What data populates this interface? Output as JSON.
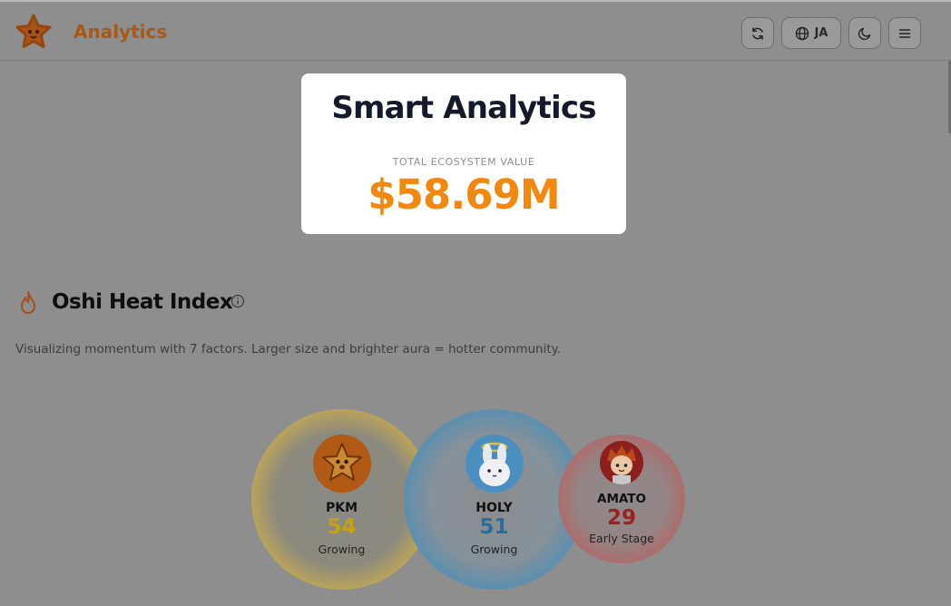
{
  "header": {
    "brand": "Analytics",
    "lang_label": "JA",
    "icons": [
      "refresh-icon",
      "globe-icon",
      "moon-icon",
      "menu-icon"
    ]
  },
  "card": {
    "title": "Smart Analytics",
    "label": "TOTAL ECOSYSTEM VALUE",
    "value": "$58.69M"
  },
  "section": {
    "title": "Oshi Heat Index",
    "description": "Visualizing momentum with 7 factors. Larger size and brighter aura = hotter community."
  },
  "bubbles": [
    {
      "name": "PKM",
      "score": "54",
      "status": "Growing",
      "score_color": "#c7a20e"
    },
    {
      "name": "HOLY",
      "score": "51",
      "status": "Growing",
      "score_color": "#2a6c9a"
    },
    {
      "name": "AMATO",
      "score": "29",
      "status": "Early Stage",
      "score_color": "#9c2020"
    }
  ],
  "colors": {
    "brand": "#a7581a",
    "accent": "#f4880f",
    "title": "#141a2c"
  }
}
